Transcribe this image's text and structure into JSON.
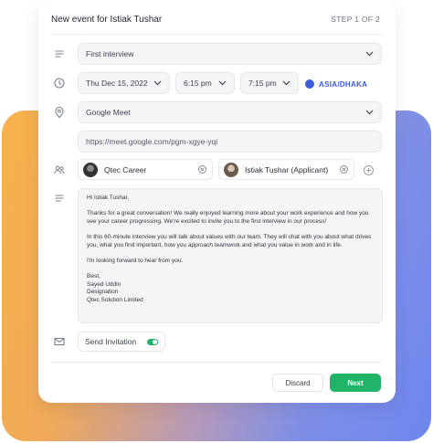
{
  "header": {
    "title": "New event for Istiak Tushar",
    "step": "STEP 1 OF 2"
  },
  "event_type": {
    "value": "First interview"
  },
  "schedule": {
    "date": "Thu Dec 15, 2022",
    "start_time": "6:15 pm",
    "end_time": "7:15 pm",
    "timezone": "ASIA/DHAKA"
  },
  "location": {
    "value": "Google Meet",
    "link": "https://meet.google.com/pgm-xgye-yqi"
  },
  "participants": [
    {
      "name": "Qtec Career"
    },
    {
      "name": "Istiak Tushar (Applicant)"
    }
  ],
  "message": {
    "greeting": "Hi Istiak Tushar,",
    "p1": "Thanks for a great conversation! We really enjoyed learning more about your work experience and how you see your career progressing. We're excited to invite you to the first interview in our process!",
    "p2": "In this 60-minute interview you will talk about values with our team. They will chat with you about what drives you, what you find important, how you approach teamwork and what you value in work and in life.",
    "p3": "I'm looking forward to hear from you.",
    "sign_off": "Best,",
    "sender_name": "Sayed Uddin",
    "sender_title": "Designation",
    "company": "Qtec Solution Limited"
  },
  "send_invitation": {
    "label": "Send Invitation",
    "enabled": true
  },
  "footer": {
    "discard_label": "Discard",
    "next_label": "Next"
  },
  "colors": {
    "accent": "#1fb467",
    "timezone": "#3b5bd9"
  }
}
